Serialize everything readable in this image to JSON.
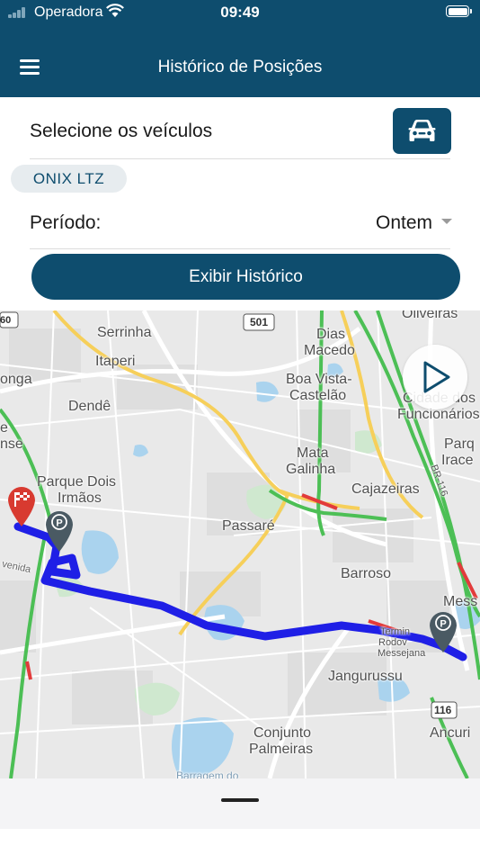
{
  "status_bar": {
    "carrier": "Operadora",
    "time": "09:49"
  },
  "header": {
    "title": "Histórico de Posições"
  },
  "vehicle_select": {
    "label": "Selecione os veículos",
    "car_icon": "car-icon"
  },
  "selected_vehicles": [
    "ONIX LTZ"
  ],
  "period": {
    "label": "Período:",
    "value": "Ontem"
  },
  "show_history_button": "Exibir Histórico",
  "map": {
    "labels": {
      "oliveiras": "Oliveiras",
      "serrinha": "Serrinha",
      "itaperi": "Itaperi",
      "dias": "Dias",
      "macedo": "Macedo",
      "onga": "onga",
      "boa_vista": "Boa Vista-",
      "castelao": "Castelão",
      "cidade_dos": "Cidade dos",
      "funcionarios": "Funcionários",
      "dende": "Dendê",
      "nse": "nse",
      "mata": "Mata",
      "galinha": "Galinha",
      "parq": "Parq",
      "irace": "Irace",
      "parque_dois": "Parque Dois",
      "irmaos": "Irmãos",
      "cajazeiras": "Cajazeiras",
      "passare": "Passaré",
      "barroso": "Barroso",
      "mess": "Mess",
      "jangurussu": "Jangurussu",
      "conjunto": "Conjunto",
      "palmeiras": "Palmeiras",
      "ancuri": "Ancuri",
      "barragem": "Barragem do",
      "terminal": "Termin",
      "rodov": "Rodov",
      "messejana": "Messejana",
      "avenida": "venida",
      "br116": "BR-116"
    },
    "shields": {
      "r60": "60",
      "r501": "501",
      "r116": "116"
    },
    "route_color": "#1f1fe6",
    "end_marker_color": "#d83a30",
    "parking_marker_color": "#4a5a63"
  },
  "colors": {
    "primary": "#0e4d6e",
    "chip_bg": "#e7ecef"
  }
}
